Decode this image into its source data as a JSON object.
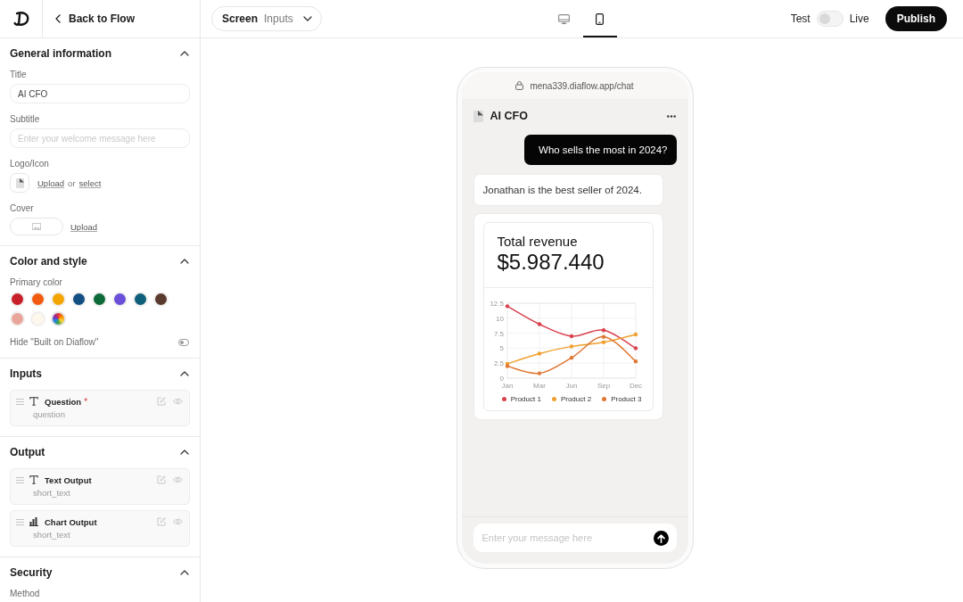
{
  "sidebar_header": {
    "back_label": "Back to Flow"
  },
  "general_information": {
    "heading": "General information",
    "expanded": true,
    "title": {
      "label": "Title",
      "value": "AI CFO"
    },
    "subtitle": {
      "label": "Subtitle",
      "placeholder": "Enter your welcome message here"
    },
    "logo": {
      "label": "Logo/Icon",
      "upload_link": "Upload",
      "joiner": "or",
      "select_link": "select"
    },
    "cover": {
      "label": "Cover",
      "upload_link": "Upload"
    }
  },
  "color_and_style": {
    "heading": "Color and style",
    "expanded": true,
    "primary_color_label": "Primary color",
    "swatches": [
      {
        "kind": "color",
        "color": "#c8202a"
      },
      {
        "kind": "color",
        "color": "#f15a0f"
      },
      {
        "kind": "color",
        "color": "#f5a500"
      },
      {
        "kind": "color",
        "color": "#114e83"
      },
      {
        "kind": "color",
        "color": "#0d6b3a"
      },
      {
        "kind": "color",
        "color": "#6a4fd8"
      },
      {
        "kind": "color",
        "color": "#0d5f7a"
      },
      {
        "kind": "color",
        "color": "#5a3a2c"
      },
      {
        "kind": "color",
        "color": "#e8a59a"
      },
      {
        "kind": "color",
        "color": "#fdf7ec"
      },
      {
        "kind": "custom"
      }
    ],
    "hide_branding": {
      "label": "Hide \"Built on Diaflow\"",
      "on": false
    }
  },
  "inputs": {
    "heading": "Inputs",
    "expanded": true,
    "items": [
      {
        "kind": "text",
        "name": "Question",
        "required_mark": "*",
        "variable": "question"
      }
    ]
  },
  "output": {
    "heading": "Output",
    "expanded": true,
    "items": [
      {
        "kind": "text",
        "name": "Text Output",
        "variable": "short_text"
      },
      {
        "kind": "chart",
        "name": "Chart Output",
        "variable": "short_text"
      }
    ]
  },
  "security": {
    "heading": "Security",
    "expanded": true,
    "method_label": "Method"
  },
  "topbar": {
    "screen_label": "Screen",
    "screen_value": "Inputs",
    "device_tabs": [
      {
        "kind": "desktop",
        "selected": false
      },
      {
        "kind": "mobile",
        "selected": true
      }
    ],
    "mode_left": "Test",
    "mode_right": "Live",
    "live": false,
    "publish": "Publish"
  },
  "preview": {
    "url": "mena339.diaflow.app/chat",
    "bot_name": "AI CFO",
    "messages": [
      {
        "kind": "user",
        "text": "Who sells the most in 2024?"
      },
      {
        "kind": "bot",
        "text": "Jonathan is the best seller of 2024."
      },
      {
        "kind": "chart_card",
        "title": "Total revenue",
        "value": "$5.987.440",
        "chart_data": [
          {
            "type": "line",
            "categories": [
              "Jan",
              "Mar",
              "Jun",
              "Sep",
              "Dec"
            ],
            "yticks": [
              0,
              2.5,
              5,
              7.5,
              10,
              12.5
            ],
            "ylim": [
              0,
              12.5
            ],
            "grid": true,
            "legend": "bottom",
            "series": [
              {
                "name": "Product 1",
                "color": "#d9414f",
                "values": [
                  12,
                  9,
                  7,
                  8,
                  5
                ]
              },
              {
                "name": "Product 2",
                "color": "#f0a030",
                "values": [
                  2.4,
                  4.1,
                  5.3,
                  6,
                  7.3
                ]
              },
              {
                "name": "Product 3",
                "color": "#e07835",
                "values": [
                  2,
                  0.8,
                  3.4,
                  6.9,
                  2.8
                ]
              }
            ]
          }
        ]
      }
    ],
    "composer": {
      "placeholder": "Enter your message here"
    }
  }
}
